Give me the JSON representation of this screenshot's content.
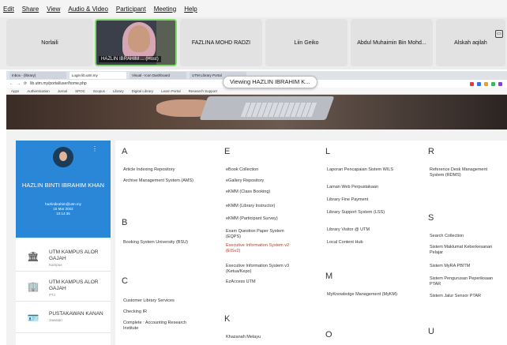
{
  "menubar": [
    "Edit",
    "Share",
    "View",
    "Audio & Video",
    "Participant",
    "Meeting",
    "Help"
  ],
  "participants": [
    {
      "name": "Norlaili"
    },
    {
      "name": "HAZLIN IBRAHIM ...",
      "host": "(Host)"
    },
    {
      "name": "FAZLINA MOHD RADZI"
    },
    {
      "name": "Liin Geiko"
    },
    {
      "name": "Abdul Muhaimin Bin Mohd..."
    },
    {
      "name": "Alskah aqilah"
    }
  ],
  "sharing_banner": "Viewing HAZLIN IBRAHIM K...",
  "browser": {
    "tabs": [
      "Inbox - (library)",
      "Login lib.utm.my",
      "Visual - Icon Dashboard",
      "UTM Library Portal"
    ],
    "url": "lib.utm.my/portal/user/home.php",
    "bookmarks": [
      "Apps",
      "Authentication",
      "Jurnal",
      "SPOC",
      "Scopus",
      "Library",
      "Digital Library",
      "Learn Portal",
      "Research Support"
    ]
  },
  "profile": {
    "name": "HAZLIN BINTI IBRAHIM KHAN",
    "email": "hazlinibrahim@utm.my",
    "date": "15 Mar 2022",
    "time": "10:14:35"
  },
  "info_rows": [
    {
      "icon": "bank-icon",
      "glyph": "🏛",
      "title": "UTM KAMPUS ALOR GAJAH",
      "sub": "Kampus"
    },
    {
      "icon": "building-icon",
      "glyph": "🏢",
      "title": "UTM KAMPUS ALOR GAJAH",
      "sub": "PTJ"
    },
    {
      "icon": "id-card-icon",
      "glyph": "🪪",
      "title": "PUSTAKAWAN KANAN",
      "sub": "Jawatan"
    }
  ],
  "directory": [
    {
      "letter": "A",
      "items": [
        "Article Indexing Repository",
        "Archive Management System (AMS)"
      ]
    },
    {
      "letter": "B",
      "items": [
        "Booking System University (BSU)"
      ]
    },
    {
      "letter": "C",
      "items": [
        "Customer Library Services",
        "Checking IR",
        "Complete : Accounting Research Institute"
      ]
    },
    {
      "letter": "E",
      "items": [
        "eBook Collection",
        "eGallery Repository",
        "eKMM (Class Booking)",
        "eKMM (Library Instructor)",
        "eKMM (Participant Survey)",
        "Exam Question Paper System (EQPS)",
        "Executive Information System v2 (EISv2)",
        "Executive Information System v3 (Ketua/Kepo)",
        "EzAccess UTM"
      ]
    },
    {
      "letter": "K",
      "items": [
        "Khazanah Melayu"
      ]
    },
    {
      "letter": "L",
      "items": [
        "Laporan Pencapaian Sistem WILS",
        "Laman Web Perpustakaan",
        "Library Fine Payment",
        "Library Support System (LSS)",
        "Library Visitor @ UTM",
        "Local Content Hub"
      ]
    },
    {
      "letter": "M",
      "items": [
        "MyKnowledge Management (MyKM)"
      ]
    },
    {
      "letter": "O",
      "items": []
    },
    {
      "letter": "R",
      "items": [
        "Reference Desk Management System (RDMS)"
      ]
    },
    {
      "letter": "S",
      "items": [
        "Search Collection",
        "Sistem Maklumat Keberkesanan Pelajar",
        "Sistem MyRA PBITM",
        "Sistem Pengurusan Peperiksaan PTAR",
        "Sistem Jalur Sensor PTAR"
      ]
    },
    {
      "letter": "U",
      "items": []
    }
  ]
}
